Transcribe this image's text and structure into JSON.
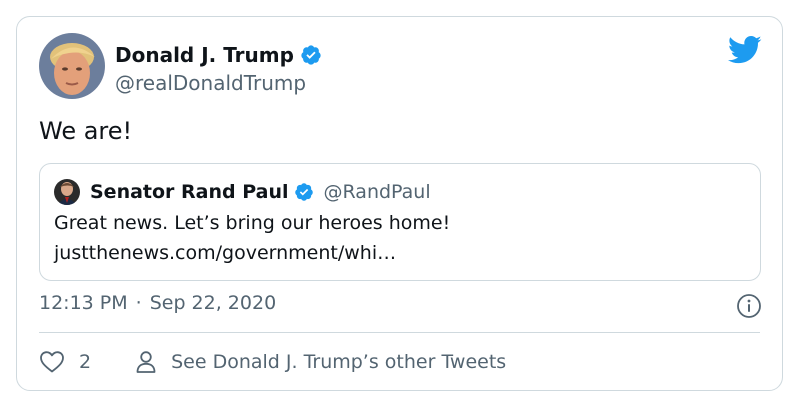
{
  "author": {
    "name": "Donald J. Trump",
    "handle": "@realDonaldTrump",
    "verified": true
  },
  "tweet": {
    "text": "We are!"
  },
  "quoted": {
    "name": "Senator Rand Paul",
    "handle": "@RandPaul",
    "verified": true,
    "line1": "Great news. Let’s bring our heroes home!",
    "line2": "justthenews.com/government/whi…"
  },
  "meta": {
    "time": "12:13 PM",
    "separator": "·",
    "date": "Sep 22, 2020"
  },
  "actions": {
    "like_count": "2",
    "see_other": "See Donald J. Trump’s other Tweets"
  },
  "colors": {
    "twitter_blue": "#1d9bf0",
    "secondary_text": "#536471",
    "border": "#cfd9de"
  }
}
